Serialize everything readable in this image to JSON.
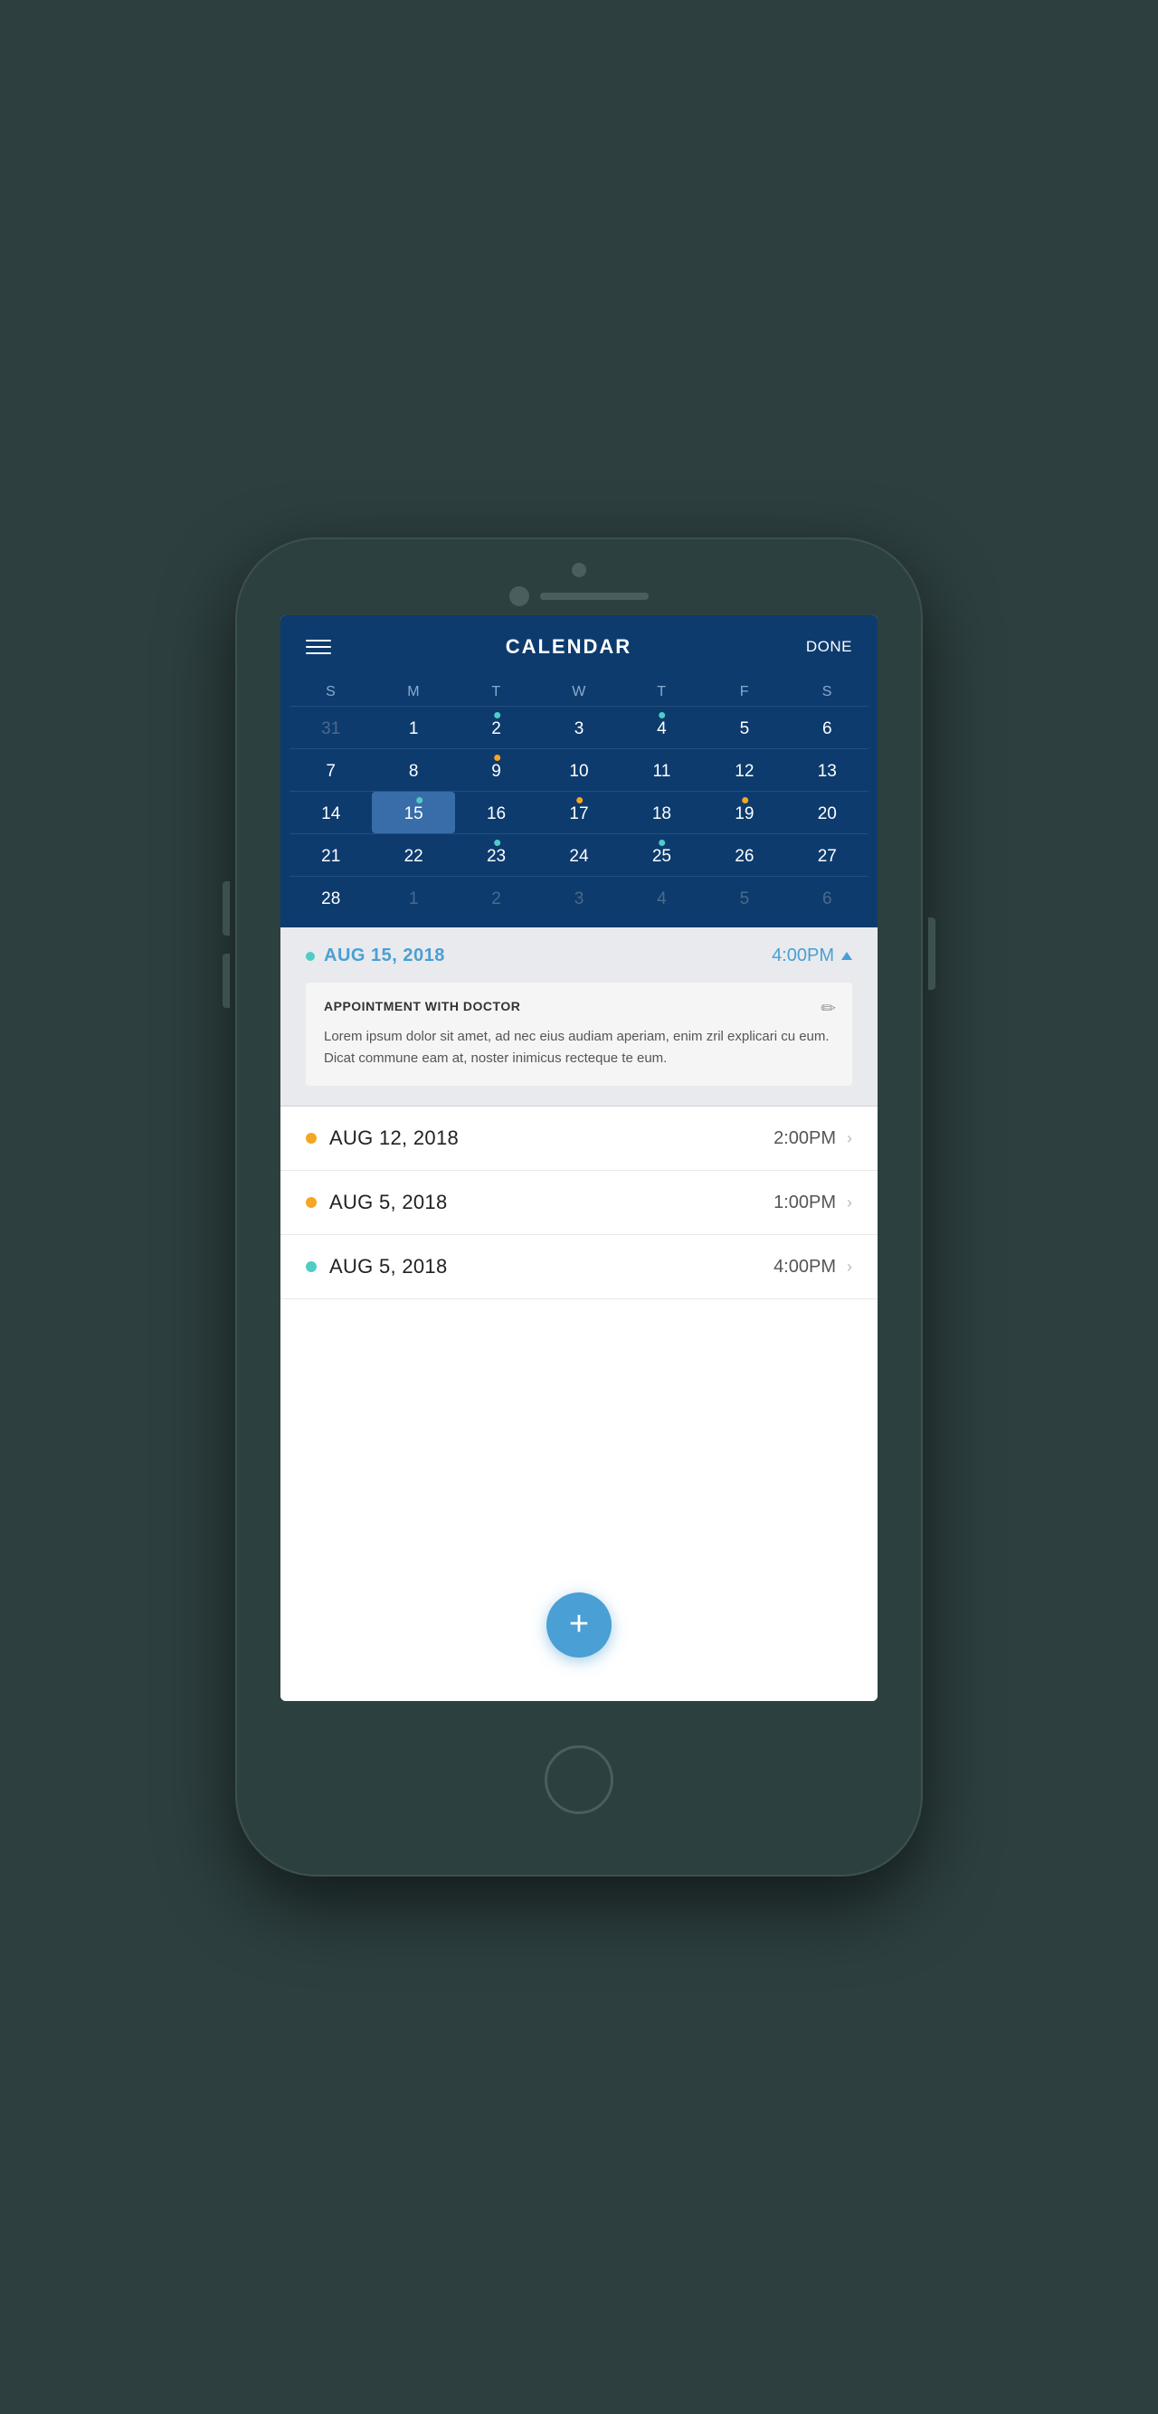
{
  "header": {
    "title": "CALENDAR",
    "done_label": "DONE"
  },
  "calendar": {
    "day_headers": [
      "S",
      "M",
      "T",
      "W",
      "T",
      "F",
      "S"
    ],
    "weeks": [
      [
        {
          "day": "31",
          "other": true,
          "dots": []
        },
        {
          "day": "1",
          "other": false,
          "dots": []
        },
        {
          "day": "2",
          "other": false,
          "dots": [
            {
              "color": "teal"
            }
          ]
        },
        {
          "day": "3",
          "other": false,
          "dots": []
        },
        {
          "day": "4",
          "other": false,
          "dots": [
            {
              "color": "teal"
            }
          ]
        },
        {
          "day": "5",
          "other": false,
          "dots": []
        },
        {
          "day": "6",
          "other": false,
          "dots": []
        }
      ],
      [
        {
          "day": "7",
          "other": false,
          "dots": []
        },
        {
          "day": "8",
          "other": false,
          "dots": []
        },
        {
          "day": "9",
          "other": false,
          "dots": [
            {
              "color": "orange"
            }
          ]
        },
        {
          "day": "10",
          "other": false,
          "dots": []
        },
        {
          "day": "11",
          "other": false,
          "dots": []
        },
        {
          "day": "12",
          "other": false,
          "dots": []
        },
        {
          "day": "13",
          "other": false,
          "dots": []
        }
      ],
      [
        {
          "day": "14",
          "other": false,
          "dots": []
        },
        {
          "day": "15",
          "other": false,
          "selected": true,
          "dots": [
            {
              "color": "teal"
            }
          ]
        },
        {
          "day": "16",
          "other": false,
          "dots": []
        },
        {
          "day": "17",
          "other": false,
          "dots": [
            {
              "color": "orange"
            }
          ]
        },
        {
          "day": "18",
          "other": false,
          "dots": []
        },
        {
          "day": "19",
          "other": false,
          "dots": [
            {
              "color": "orange"
            }
          ]
        },
        {
          "day": "20",
          "other": false,
          "dots": []
        }
      ],
      [
        {
          "day": "21",
          "other": false,
          "dots": []
        },
        {
          "day": "22",
          "other": false,
          "dots": []
        },
        {
          "day": "23",
          "other": false,
          "dots": [
            {
              "color": "teal"
            }
          ]
        },
        {
          "day": "24",
          "other": false,
          "dots": []
        },
        {
          "day": "25",
          "other": false,
          "dots": [
            {
              "color": "teal"
            }
          ]
        },
        {
          "day": "26",
          "other": false,
          "dots": []
        },
        {
          "day": "27",
          "other": false,
          "dots": []
        }
      ],
      [
        {
          "day": "28",
          "other": false,
          "dots": []
        },
        {
          "day": "1",
          "other": true,
          "dots": []
        },
        {
          "day": "2",
          "other": true,
          "dots": []
        },
        {
          "day": "3",
          "other": true,
          "dots": []
        },
        {
          "day": "4",
          "other": true,
          "dots": []
        },
        {
          "day": "5",
          "other": true,
          "dots": []
        },
        {
          "day": "6",
          "other": true,
          "dots": []
        }
      ]
    ]
  },
  "selected_event": {
    "dot_color": "teal",
    "date": "AUG 15, 2018",
    "time": "4:00PM",
    "title": "APPOINTMENT WITH DOCTOR",
    "description": "Lorem ipsum dolor sit amet, ad nec eius audiam aperiam, enim zril explicari cu eum. Dicat commune eam at, noster inimicus recteque te eum."
  },
  "events_list": [
    {
      "dot_color": "orange",
      "date": "AUG 12, 2018",
      "time": "2:00PM"
    },
    {
      "dot_color": "orange",
      "date": "AUG 5, 2018",
      "time": "1:00PM"
    },
    {
      "dot_color": "teal",
      "date": "AUG 5, 2018",
      "time": "4:00PM"
    }
  ],
  "fab": {
    "label": "+"
  }
}
